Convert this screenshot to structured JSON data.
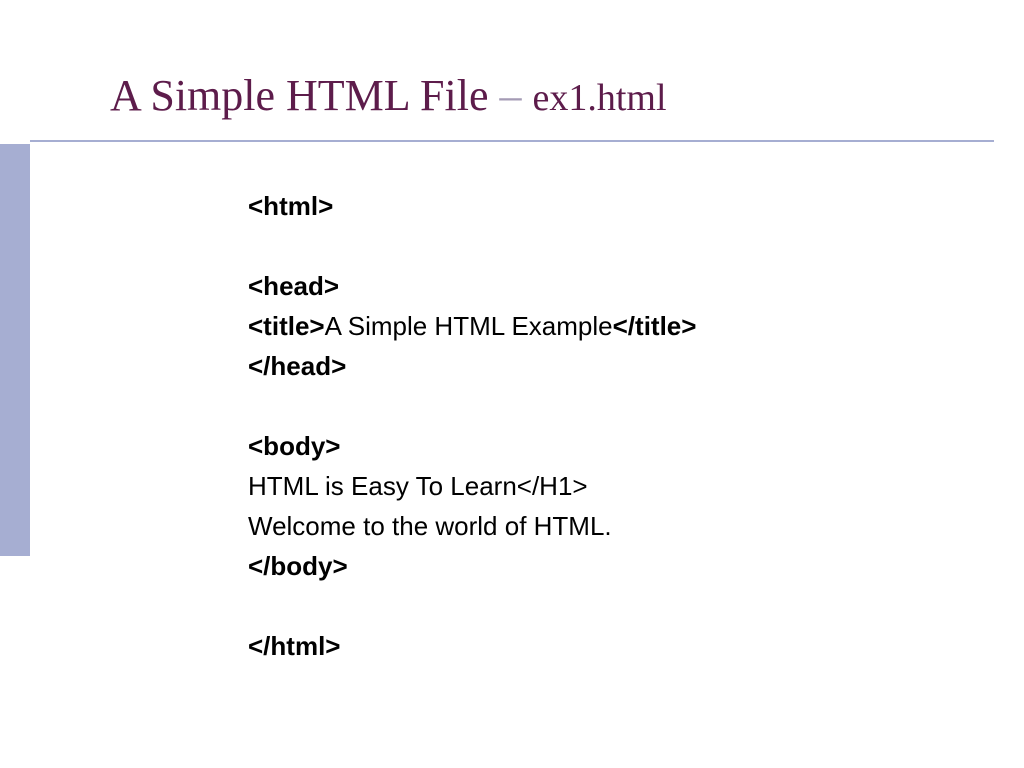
{
  "title": {
    "main": "A Simple HTML File",
    "separator": " – ",
    "file": "ex1.html"
  },
  "code": {
    "l1_b": "<html>",
    "l2_b": "<head>",
    "l3_b1": "<title>",
    "l3_txt": "A Simple HTML Example",
    "l3_b2": "</title>",
    "l4_b": "</head>",
    "l5_b": "<body>",
    "l6_txt": "HTML is Easy To Learn</H1>",
    "l7_txt": "Welcome to the world of HTML.",
    "l8_b": "</body>",
    "l9_b": "</html>"
  }
}
